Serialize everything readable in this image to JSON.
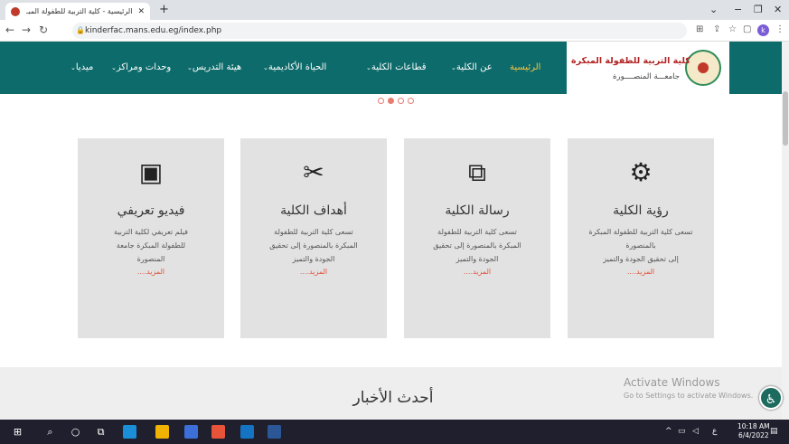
{
  "browser": {
    "tab_title": "الرئيسية - كلية التربية للطفولة المبـ",
    "tab_close": "✕",
    "new_tab": "+",
    "url": "kinderfac.mans.edu.eg/index.php",
    "profile_initial": "k"
  },
  "site": {
    "college_name": "كلية التربية للطفولة المبكرة",
    "university": "جامعـــة المنصــــورة",
    "menu": [
      {
        "label": "الرئيسية"
      },
      {
        "label": "عن الكلية"
      },
      {
        "label": "قطاعات الكلية"
      },
      {
        "label": "الحياة الأكاديمية"
      },
      {
        "label": "هيئة التدريس"
      },
      {
        "label": "وحدات ومراكز"
      },
      {
        "label": "ميديا"
      }
    ],
    "slider_active_index": 1,
    "slider_dot_count": 4
  },
  "cards": [
    {
      "icon": "gears-icon",
      "title": "رؤية الكلية",
      "lines": [
        "تسعى كلية التربية للطفولة المبكرة",
        "بالمنصورة",
        "إلى تحقيق الجودة والتميز"
      ],
      "more": "المزيد...."
    },
    {
      "icon": "copy-icon",
      "title": "رسالة الكلية",
      "lines": [
        "تسعى كلية التربية للطفولة",
        "المبكرة بالمنصورة إلى تحقيق",
        "الجودة والتميز"
      ],
      "more": "المزيد...."
    },
    {
      "icon": "tools-icon",
      "title": "أهداف الكلية",
      "lines": [
        "تسعى كلية التربية للطفولة",
        "المبكرة بالمنصورة إلى تحقيق",
        "الجودة والتميز"
      ],
      "more": "المزيد...."
    },
    {
      "icon": "camera-icon",
      "title": "فيديو تعريفي",
      "lines": [
        "فيلم تعريفي لكلية التربية",
        "للطفولة المبكرة جامعة",
        "المنصورة"
      ],
      "more": "المزيد...."
    }
  ],
  "news": {
    "title": "أحدث الأخبار"
  },
  "watermark": {
    "line1": "Activate Windows",
    "line2": "Go to Settings to activate Windows."
  },
  "taskbar": {
    "time": "10:18 AM",
    "date": "6/4/2022",
    "lang": "ع"
  }
}
